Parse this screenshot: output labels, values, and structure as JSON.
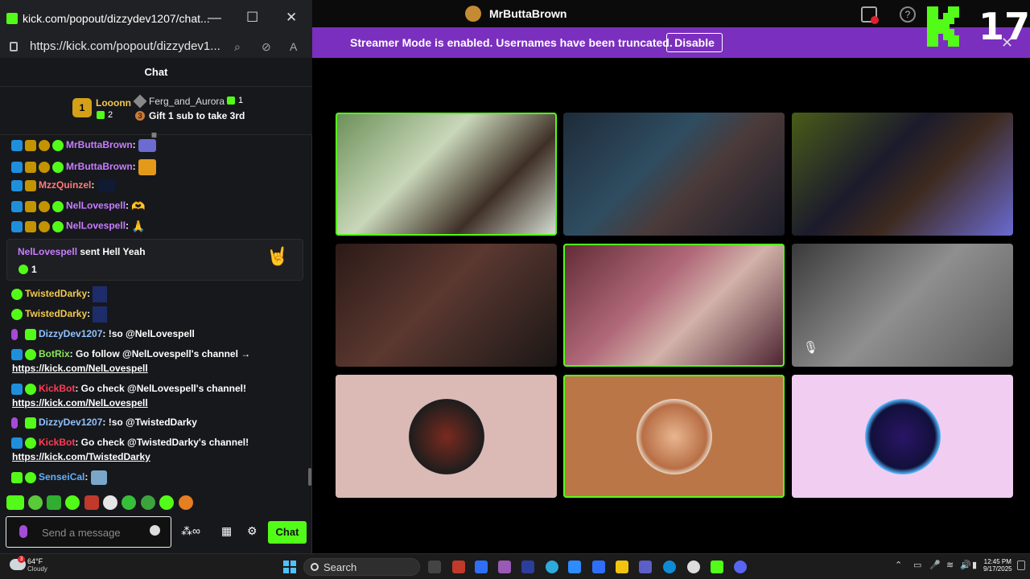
{
  "popout": {
    "title": "kick.com/popout/dizzydev1207/chat...",
    "url": "https://kick.com/popout/dizzydev1...",
    "chat_header": "Chat",
    "leaderboard": {
      "first": {
        "rank": "1",
        "name": "Looonn",
        "subs": "2"
      },
      "second": {
        "name": "Ferg_and_Aurora",
        "subs": "1"
      },
      "third": {
        "rank": "3",
        "text": "Gift 1 sub to take 3rd"
      }
    }
  },
  "chat": {
    "messages": [
      {
        "user": "MrButtaBrown",
        "text": ":"
      },
      {
        "user": "MrButtaBrown",
        "text": ":"
      },
      {
        "user": "MzzQuinzel",
        "text": ":"
      },
      {
        "user": "NelLovespell",
        "text": ":"
      },
      {
        "user": "NelLovespell",
        "text": ":"
      },
      {
        "user": "TwistedDarky",
        "text": ":"
      },
      {
        "user": "TwistedDarky",
        "text": ":"
      },
      {
        "user": "DizzyDev1207",
        "text": ": !so @NelLovespell"
      },
      {
        "user": "BotRix",
        "text": ": Go follow @NelLovespell's channel →",
        "link": "https://kick.com/NelLovespell"
      },
      {
        "user": "KickBot",
        "text": ": Go check @NelLovespell's channel!",
        "link": "https://kick.com/NelLovespell"
      },
      {
        "user": "DizzyDev1207",
        "text": ": !so @TwistedDarky"
      },
      {
        "user": "KickBot",
        "text": ": Go check @TwistedDarky's channel!",
        "link": "https://kick.com/TwistedDarky"
      },
      {
        "user": "SenseiCal",
        "text": ":"
      }
    ],
    "gift_card": {
      "user": "NelLovespell",
      "text": "sent Hell Yeah",
      "amount": "1"
    }
  },
  "composer": {
    "placeholder": "Send a message",
    "send_label": "Chat"
  },
  "app": {
    "channel_name": "MrButtaBrown",
    "streamer_notice": "Streamer Mode is enabled. Usernames have been truncated.",
    "disable_label": "Disable",
    "overlay_count": "17"
  },
  "taskbar": {
    "temp": "64°F",
    "condition": "Cloudy",
    "search_label": "Search",
    "time": "12:45 PM",
    "date": "9/17/2025",
    "weather_badge": "3"
  },
  "colors": {
    "kick_green": "#53fc18",
    "streamer_bar": "#7b2fbf",
    "username_purple": "#c77dff",
    "username_green": "#8ee55a",
    "kickbot_red": "#ff3d55"
  }
}
